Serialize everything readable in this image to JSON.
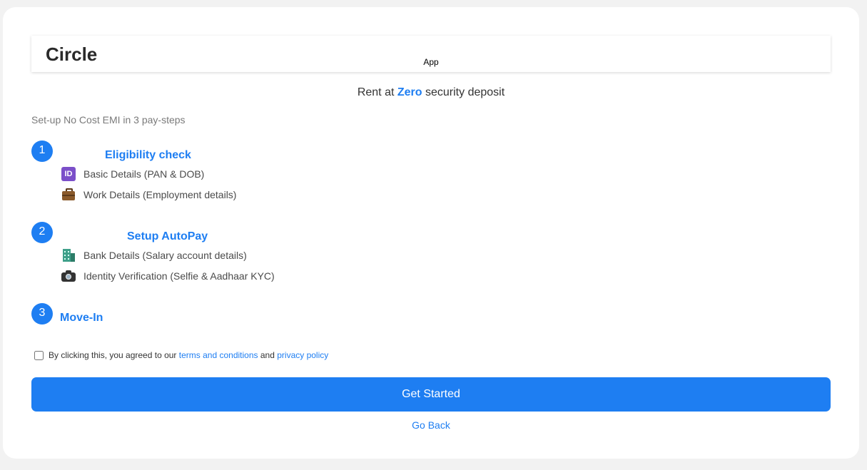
{
  "header": {
    "brand": "Circle",
    "app_label": "App"
  },
  "tagline": {
    "prefix": "Rent at",
    "highlight": "Zero",
    "suffix": "security deposit"
  },
  "subtitle": "Set-up No Cost EMI in 3 pay-steps",
  "steps": [
    {
      "number": "1",
      "title": "Eligibility check",
      "items": [
        {
          "icon": "id-icon",
          "icon_text": "ID",
          "label": "Basic Details (PAN & DOB)"
        },
        {
          "icon": "briefcase-icon",
          "label": "Work Details (Employment details)"
        }
      ]
    },
    {
      "number": "2",
      "title": "Setup AutoPay",
      "items": [
        {
          "icon": "bank-building-icon",
          "label": "Bank Details (Salary account details)"
        },
        {
          "icon": "camera-icon",
          "label": "Identity Verification (Selfie & Aadhaar KYC)"
        }
      ]
    },
    {
      "number": "3",
      "title": "Move-In",
      "items": []
    }
  ],
  "consent": {
    "checked": false,
    "text_before": "By clicking this, you agreed to our",
    "terms_link": "terms and conditions",
    "text_mid": "and",
    "privacy_link": "privacy policy"
  },
  "actions": {
    "primary_label": "Get Started",
    "back_label": "Go Back"
  },
  "colors": {
    "accent": "#1e7ef2",
    "page_background": "#f2f2f2",
    "card_background": "#ffffff"
  }
}
